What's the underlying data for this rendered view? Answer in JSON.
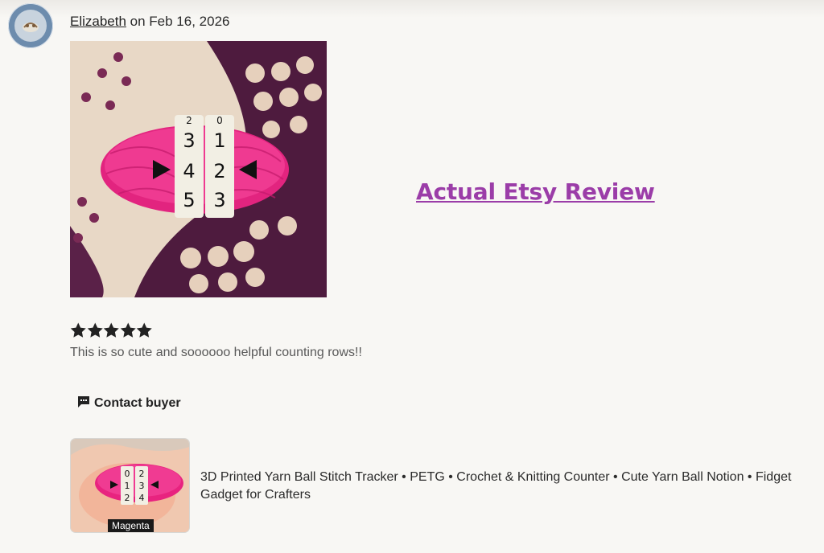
{
  "review": {
    "author": "Elizabeth",
    "date_text": " on Feb 16, 2026",
    "rating": 5,
    "rating_max": 5,
    "text": "This is so cute and soooooo helpful counting rows!!",
    "photo": {
      "counter_digits_left": [
        "2",
        "3",
        "4",
        "5"
      ],
      "counter_digits_right": [
        "0",
        "1",
        "2",
        "3"
      ]
    }
  },
  "overlay_link": "Actual Etsy Review",
  "actions": {
    "contact_label": "Contact buyer",
    "contact_icon": "chat-bubble-icon"
  },
  "product": {
    "title": "3D Printed Yarn Ball Stitch Tracker • PETG • Crochet & Knitting Counter • Cute Yarn Ball Notion • Fidget Gadget for Crafters",
    "variant": "Magenta",
    "thumb_digits_left": [
      "0",
      "1",
      "2"
    ],
    "thumb_digits_right": [
      "2",
      "3",
      "4"
    ]
  },
  "colors": {
    "accent_link": "#9b3da8",
    "yarn_pink": "#ec2a8a",
    "star": "#222222",
    "background": "#f8f7f4"
  }
}
